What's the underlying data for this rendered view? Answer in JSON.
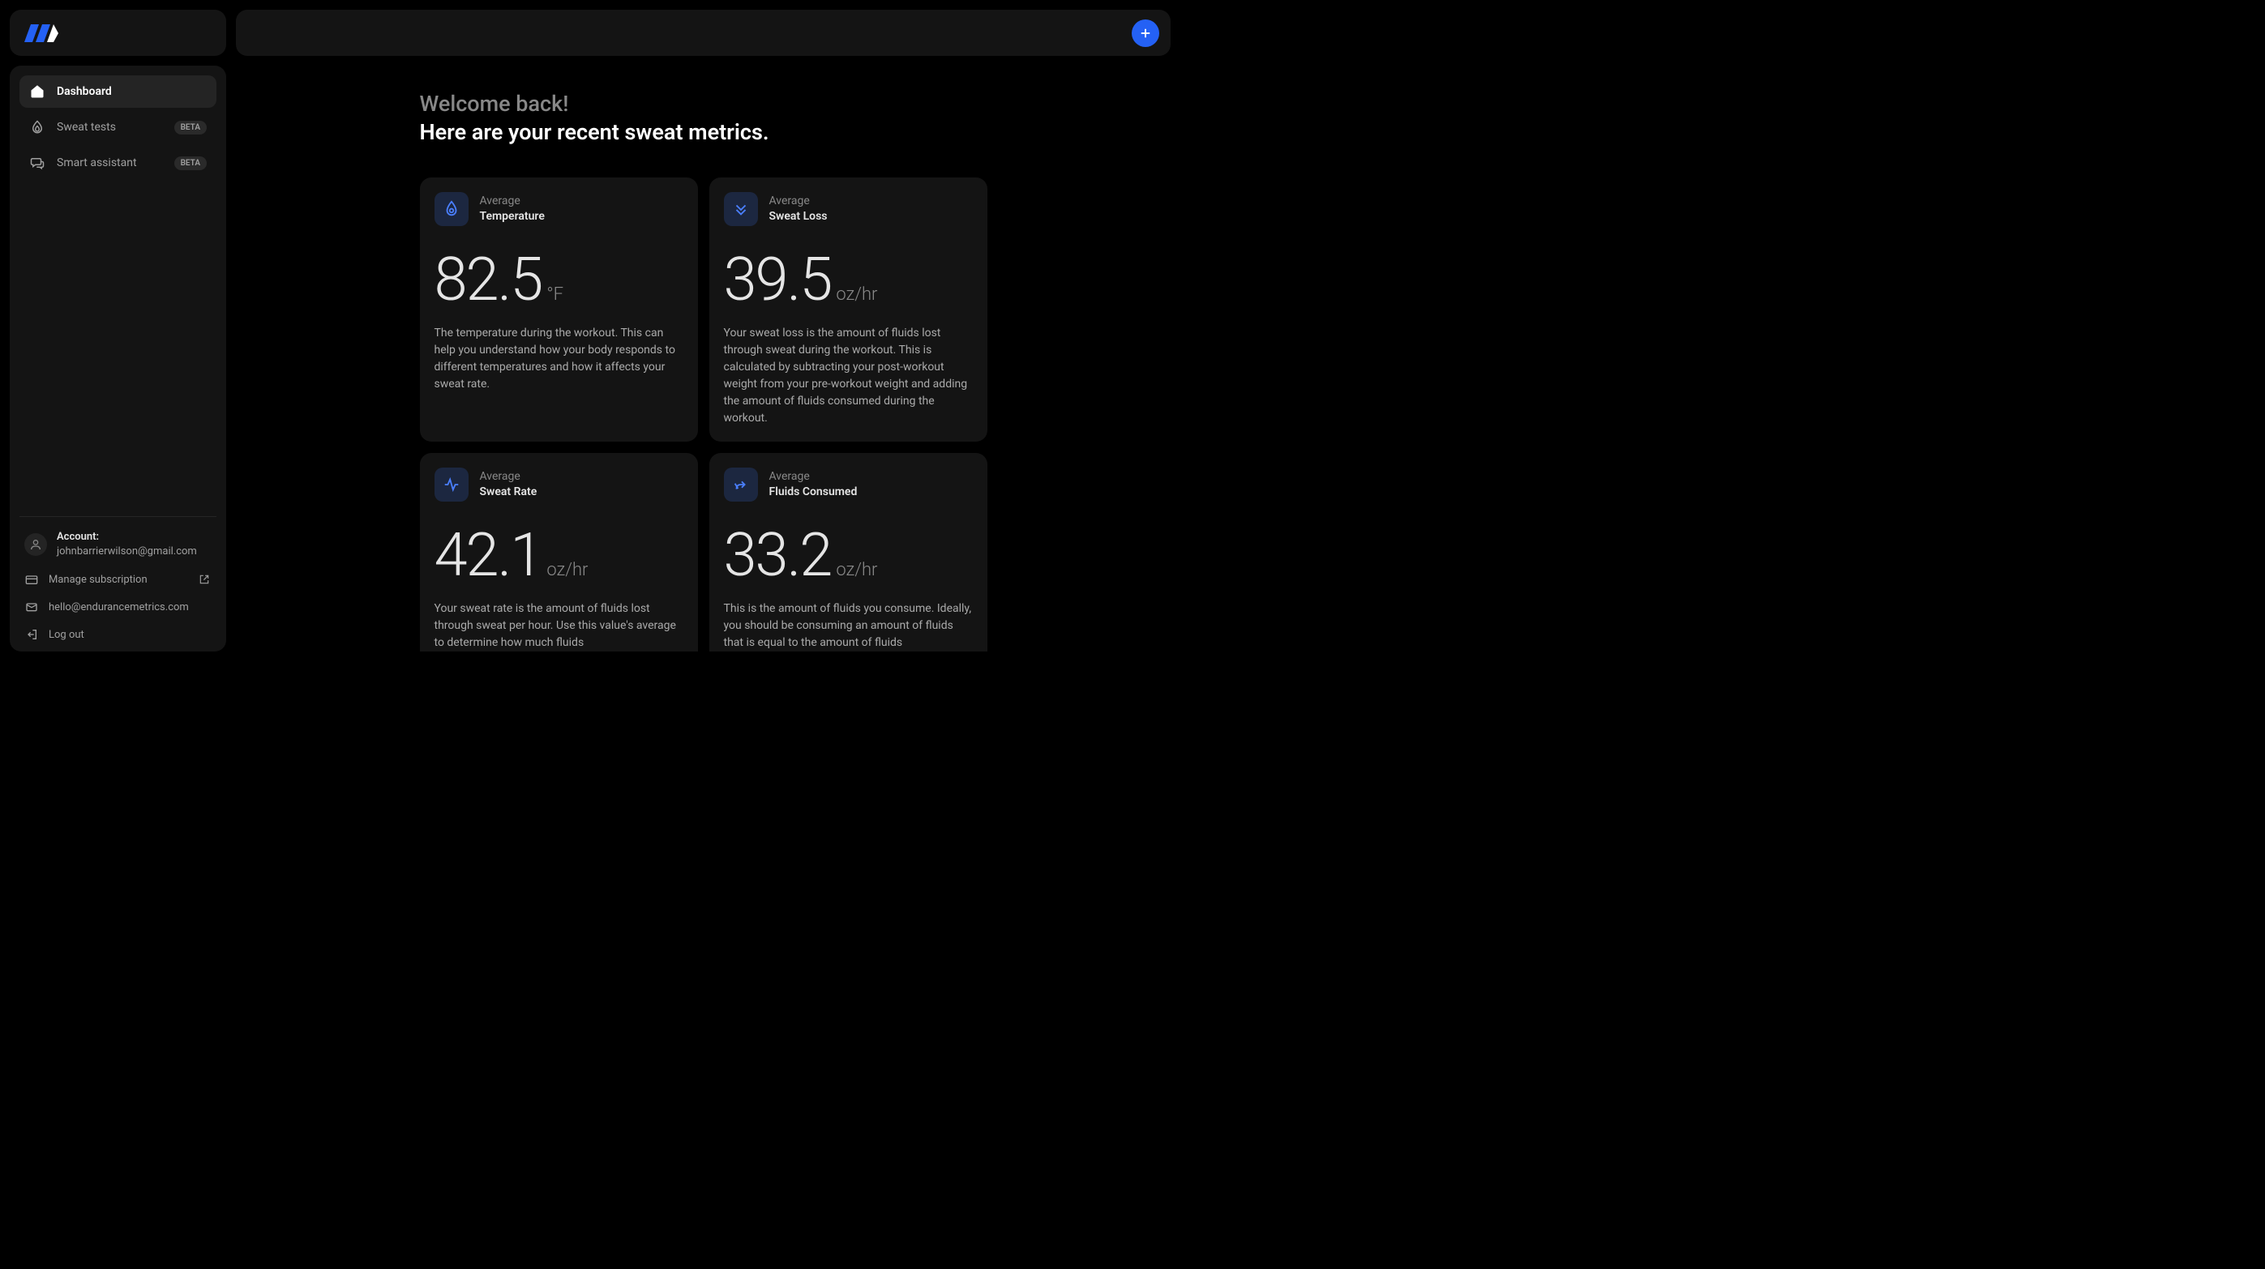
{
  "nav": {
    "items": [
      {
        "label": "Dashboard",
        "badge": null
      },
      {
        "label": "Sweat tests",
        "badge": "BETA"
      },
      {
        "label": "Smart assistant",
        "badge": "BETA"
      }
    ]
  },
  "account": {
    "label": "Account:",
    "email": "johnbarrierwilson@gmail.com"
  },
  "bottom_links": {
    "manage": "Manage subscription",
    "contact": "hello@endurancemetrics.com",
    "logout": "Log out"
  },
  "welcome": {
    "line1": "Welcome back!",
    "line2": "Here are your recent sweat metrics."
  },
  "cards": {
    "temperature": {
      "title_line1": "Average",
      "title_line2": "Temperature",
      "value": "82.5",
      "unit": "°F",
      "desc": "The temperature during the workout. This can help you understand how your body responds to different temperatures and how it affects your sweat rate."
    },
    "sweat_loss": {
      "title_line1": "Average",
      "title_line2": "Sweat Loss",
      "value": "39.5",
      "unit": "oz/hr",
      "desc": "Your sweat loss is the amount of fluids lost through sweat during the workout. This is calculated by subtracting your post-workout weight from your pre-workout weight and adding the amount of fluids consumed during the workout."
    },
    "sweat_rate": {
      "title_line1": "Average",
      "title_line2": "Sweat Rate",
      "value": "42.1",
      "unit": "oz/hr",
      "desc": "Your sweat rate is the amount of fluids lost through sweat per hour. Use this value's average to determine how much fluids"
    },
    "fluids": {
      "title_line1": "Average",
      "title_line2": "Fluids Consumed",
      "value": "33.2",
      "unit": "oz/hr",
      "desc": "This is the amount of fluids you consume. Ideally, you should be consuming an amount of fluids that is equal to the amount of fluids"
    }
  }
}
